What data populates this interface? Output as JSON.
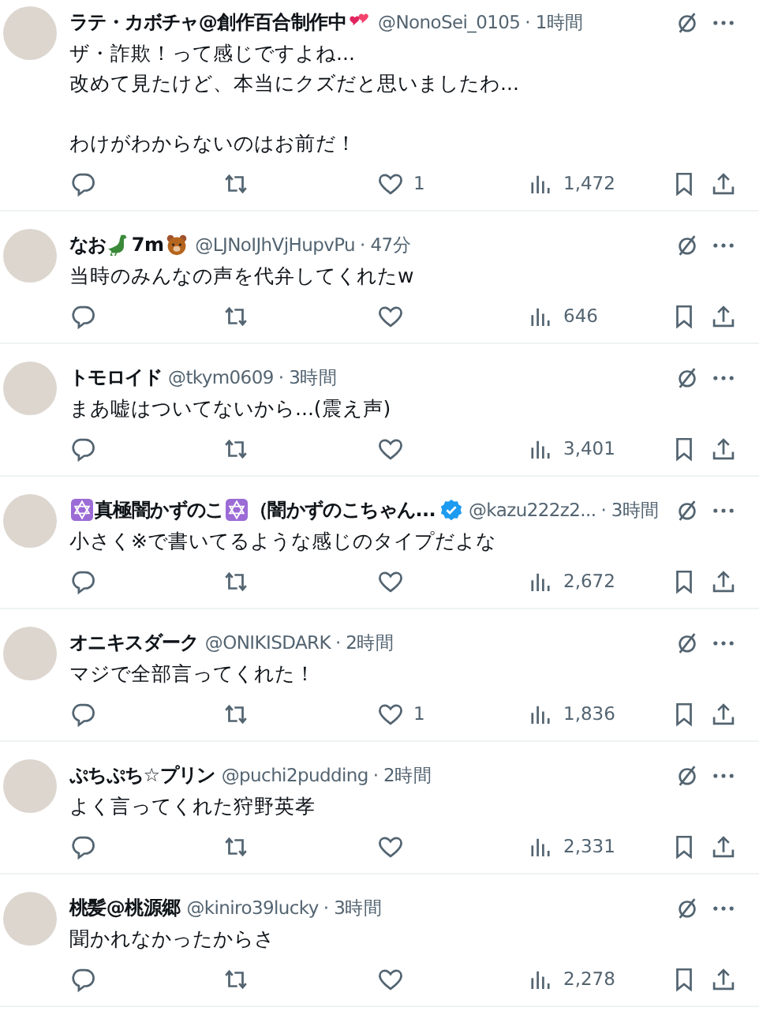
{
  "tweets": [
    {
      "name_parts": [
        {
          "kind": "text",
          "text": "ラテ・カボチャ@創作百合制作中"
        },
        {
          "kind": "hearts"
        }
      ],
      "handle": "@NonoSei_0105",
      "time": "· 1時間",
      "verified": false,
      "paragraphs": [
        [
          "ザ・詐欺！って感じですよね...",
          "改めて見たけど、本当にクズだと思いましたわ..."
        ],
        [
          "わけがわからないのはお前だ！"
        ]
      ],
      "likes": "1",
      "views": "1,472"
    },
    {
      "name_parts": [
        {
          "kind": "text",
          "text": "なお"
        },
        {
          "kind": "dinosaur"
        },
        {
          "kind": "text",
          "text": "7m"
        },
        {
          "kind": "bear"
        }
      ],
      "handle": "@LJNoIJhVjHupvPu",
      "time": "· 47分",
      "verified": false,
      "paragraphs": [
        [
          "当時のみんなの声を代弁してくれたw"
        ]
      ],
      "views": "646"
    },
    {
      "name_parts": [
        {
          "kind": "text",
          "text": "トモロイド"
        }
      ],
      "handle": "@tkym0609",
      "time": "· 3時間",
      "verified": false,
      "paragraphs": [
        [
          "まあ嘘はついてないから...(震え声)"
        ]
      ],
      "views": "3,401"
    },
    {
      "name_parts": [
        {
          "kind": "star"
        },
        {
          "kind": "text",
          "text": "真極闇かずのこ"
        },
        {
          "kind": "star"
        },
        {
          "kind": "text",
          "text": "（闇かずのこちゃん..."
        }
      ],
      "handle": "@kazu222z2...",
      "time": "· 3時間",
      "verified": true,
      "paragraphs": [
        [
          "小さく※で書いてるような感じのタイプだよな"
        ]
      ],
      "views": "2,672"
    },
    {
      "name_parts": [
        {
          "kind": "text",
          "text": "オニキスダーク"
        }
      ],
      "handle": "@ONIKISDARK",
      "time": "· 2時間",
      "verified": false,
      "paragraphs": [
        [
          "マジで全部言ってくれた！"
        ]
      ],
      "likes": "1",
      "views": "1,836"
    },
    {
      "name_parts": [
        {
          "kind": "text",
          "text": "ぷちぷち☆プリン"
        }
      ],
      "handle": "@puchi2pudding",
      "time": "· 2時間",
      "verified": false,
      "paragraphs": [
        [
          "よく言ってくれた狩野英孝"
        ]
      ],
      "views": "2,331"
    },
    {
      "name_parts": [
        {
          "kind": "text",
          "text": "桃髪@桃源郷"
        }
      ],
      "handle": "@kiniro39lucky",
      "time": "· 3時間",
      "verified": false,
      "paragraphs": [
        [
          "聞かれなかったからさ"
        ]
      ],
      "views": "2,278"
    }
  ]
}
